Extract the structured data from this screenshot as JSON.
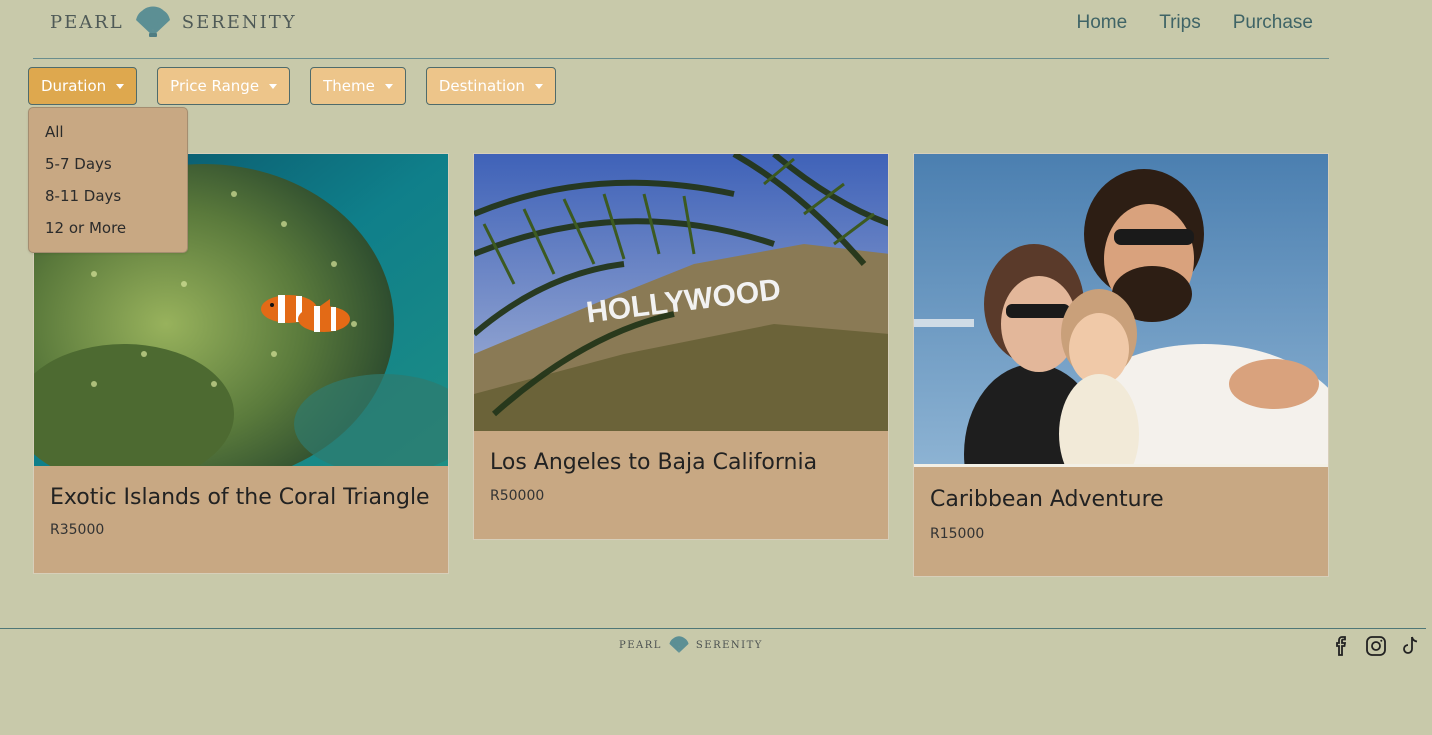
{
  "header": {
    "logo_left": "PEARL",
    "logo_right": "SERENITY",
    "nav": [
      {
        "label": "Home"
      },
      {
        "label": "Trips"
      },
      {
        "label": "Purchase"
      }
    ]
  },
  "filters": {
    "buttons": [
      {
        "label": "Duration",
        "active": true
      },
      {
        "label": "Price Range"
      },
      {
        "label": "Theme"
      },
      {
        "label": "Destination"
      }
    ],
    "duration_menu": [
      "All",
      "5-7 Days",
      "8-11 Days",
      "12 or More"
    ]
  },
  "cards": [
    {
      "title": "Exotic Islands of the Coral Triangle",
      "price": "R35000"
    },
    {
      "title": "Los Angeles to Baja California",
      "price": "R50000"
    },
    {
      "title": "Caribbean Adventure",
      "price": "R15000"
    }
  ],
  "footer": {
    "logo_left": "PEARL",
    "logo_right": "SERENITY",
    "social": [
      "facebook-icon",
      "instagram-icon",
      "tiktok-icon"
    ]
  },
  "colors": {
    "background": "#c8c9aa",
    "card": "#c8a883",
    "button": "#edc58a",
    "button_active": "#dea84e",
    "nav_text": "#3f6466",
    "rule": "#6a8d8d"
  }
}
